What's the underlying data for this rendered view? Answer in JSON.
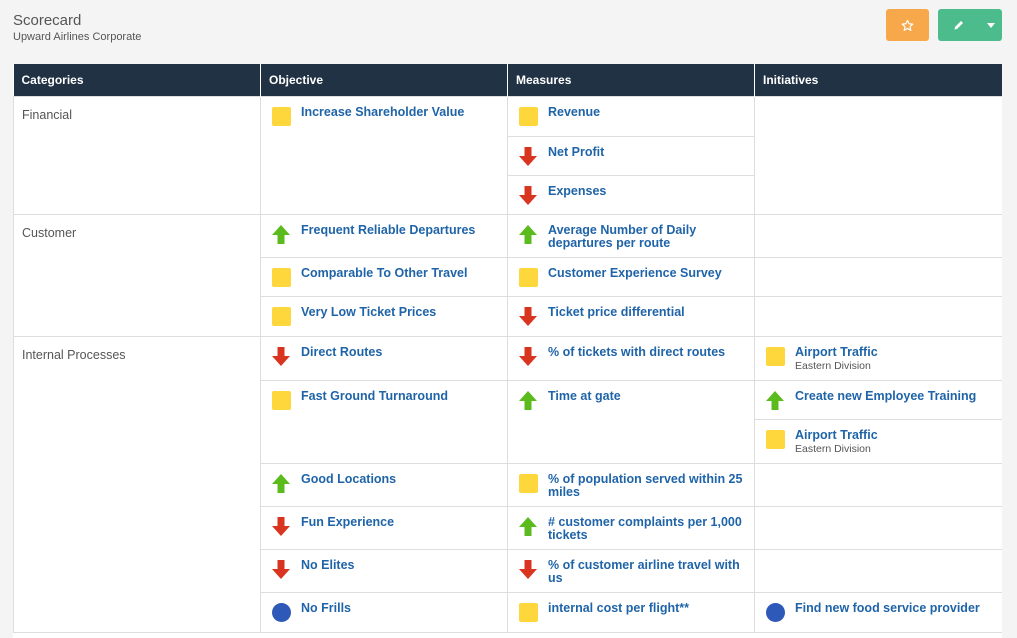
{
  "header": {
    "title": "Scorecard",
    "subtitle": "Upward Airlines Corporate"
  },
  "icons": {
    "star": "star-icon",
    "edit": "pencil-icon",
    "caret": "caret-down-icon"
  },
  "colors": {
    "accent_orange": "#f6a84b",
    "accent_green": "#4cbc8c",
    "header_bg": "#213244",
    "link": "#1f64a8",
    "yellow": "#fdd73b",
    "red": "#d9341f",
    "green": "#5bbb1d",
    "blue": "#2f59b8"
  },
  "table": {
    "headers": [
      "Categories",
      "Objective",
      "Measures",
      "Initiatives"
    ],
    "categories": [
      "Financial",
      "Customer",
      "Internal Processes"
    ],
    "objectives": [
      {
        "label": "Increase Shareholder Value",
        "status": "square"
      },
      {
        "label": "Frequent Reliable Departures",
        "status": "up"
      },
      {
        "label": "Comparable To Other Travel",
        "status": "square"
      },
      {
        "label": "Very Low Ticket Prices",
        "status": "square"
      },
      {
        "label": "Direct Routes",
        "status": "down"
      },
      {
        "label": "Fast Ground Turnaround",
        "status": "square"
      },
      {
        "label": "Good Locations",
        "status": "up"
      },
      {
        "label": "Fun Experience",
        "status": "down"
      },
      {
        "label": "No Elites",
        "status": "down"
      },
      {
        "label": "No Frills",
        "status": "circle"
      }
    ],
    "measures": [
      {
        "label": "Revenue",
        "status": "square"
      },
      {
        "label": "Net Profit",
        "status": "down"
      },
      {
        "label": "Expenses",
        "status": "down"
      },
      {
        "label": "Average Number of Daily departures per route",
        "status": "up"
      },
      {
        "label": "Customer Experience Survey",
        "status": "square"
      },
      {
        "label": "Ticket price differential",
        "status": "down"
      },
      {
        "label": "% of tickets with direct routes",
        "status": "down"
      },
      {
        "label": "Time at gate",
        "status": "up"
      },
      {
        "label": "% of population served within 25 miles",
        "status": "square"
      },
      {
        "label": "# customer complaints per 1,000 tickets",
        "status": "up"
      },
      {
        "label": "% of customer airline travel with us",
        "status": "down"
      },
      {
        "label": "internal cost per flight**",
        "status": "square"
      }
    ],
    "initiatives": [
      {
        "label": "Airport Traffic",
        "sub": "Eastern Division",
        "status": "square"
      },
      {
        "label": "Create new Employee Training",
        "sub": "",
        "status": "up"
      },
      {
        "label": "Airport Traffic",
        "sub": "Eastern Division",
        "status": "square"
      },
      {
        "label": "Find new food service provider",
        "sub": "",
        "status": "circle"
      }
    ]
  }
}
